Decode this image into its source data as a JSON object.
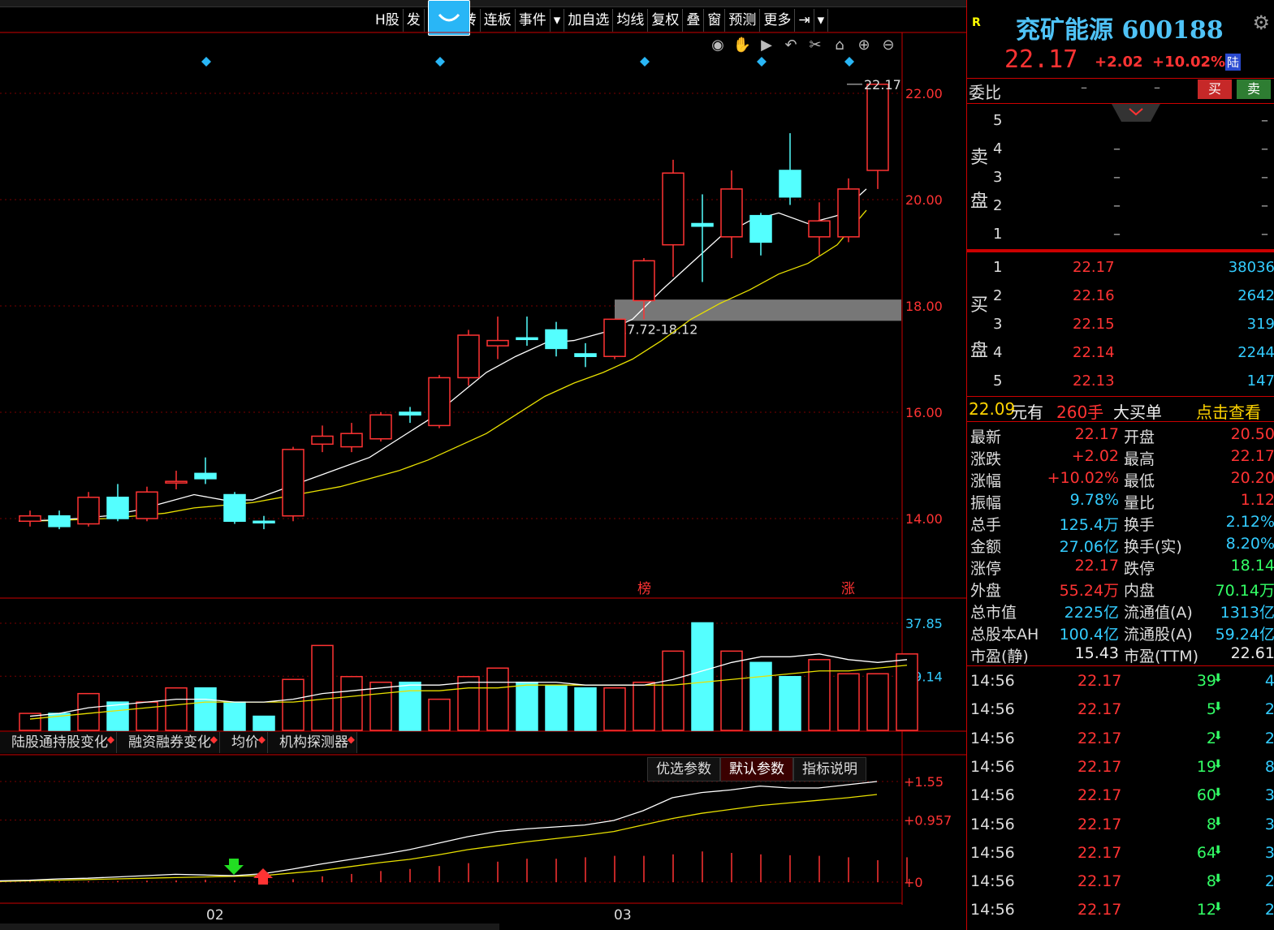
{
  "toolbar": {
    "items": [
      "H股",
      "发",
      "首",
      "九转",
      "连板",
      "事件",
      "▾",
      "加自选",
      "均线",
      "复权",
      "叠",
      "窗",
      "预测",
      "更多",
      "⇥",
      "▾"
    ]
  },
  "stock": {
    "name": "兖矿能源",
    "code": "600188",
    "badge": "R",
    "price": "22.17",
    "change": "+2.02",
    "change_pct": "+10.02%",
    "market_tag": "陆"
  },
  "weibi": {
    "label": "委比",
    "v1": "–",
    "v2": "–",
    "buy": "买",
    "sell": "卖"
  },
  "sell_side_label": [
    "卖",
    "盘"
  ],
  "buy_side_label": [
    "买",
    "盘"
  ],
  "asks": [
    {
      "level": "5",
      "price": "",
      "vol": "–"
    },
    {
      "level": "4",
      "price": "–",
      "vol": "–"
    },
    {
      "level": "3",
      "price": "–",
      "vol": "–"
    },
    {
      "level": "2",
      "price": "–",
      "vol": "–"
    },
    {
      "level": "1",
      "price": "–",
      "vol": "–"
    }
  ],
  "bids": [
    {
      "level": "1",
      "price": "22.17",
      "vol": "38036"
    },
    {
      "level": "2",
      "price": "22.16",
      "vol": "2642"
    },
    {
      "level": "3",
      "price": "22.15",
      "vol": "319"
    },
    {
      "level": "4",
      "price": "22.14",
      "vol": "2244"
    },
    {
      "level": "5",
      "price": "22.13",
      "vol": "147"
    }
  ],
  "big_order": {
    "price": "22.09",
    "yuan_you": "元有",
    "qty": "260手",
    "label": "大买单",
    "link": "点击查看"
  },
  "quote": [
    {
      "k1": "最新",
      "v1": "22.17",
      "c1": "red",
      "k2": "开盘",
      "v2": "20.50",
      "c2": "red"
    },
    {
      "k1": "涨跌",
      "v1": "+2.02",
      "c1": "red",
      "k2": "最高",
      "v2": "22.17",
      "c2": "red"
    },
    {
      "k1": "涨幅",
      "v1": "+10.02%",
      "c1": "red",
      "k2": "最低",
      "v2": "20.20",
      "c2": "red"
    },
    {
      "k1": "振幅",
      "v1": "9.78%",
      "c1": "cyan",
      "k2": "量比",
      "v2": "1.12",
      "c2": "red"
    },
    {
      "k1": "总手",
      "v1": "125.4万",
      "c1": "cyan",
      "k2": "换手",
      "v2": "2.12%",
      "c2": "cyan"
    },
    {
      "k1": "金额",
      "v1": "27.06亿",
      "c1": "cyan",
      "k2": "换手(实)",
      "v2": "8.20%",
      "c2": "cyan"
    },
    {
      "k1": "涨停",
      "v1": "22.17",
      "c1": "red",
      "k2": "跌停",
      "v2": "18.14",
      "c2": "green"
    },
    {
      "k1": "外盘",
      "v1": "55.24万",
      "c1": "red",
      "k2": "内盘",
      "v2": "70.14万",
      "c2": "green"
    },
    {
      "k1": "总市值",
      "v1": "2225亿",
      "c1": "cyan",
      "k2": "流通值(A)",
      "v2": "1313亿",
      "c2": "cyan"
    },
    {
      "k1": "总股本AH",
      "v1": "100.4亿",
      "c1": "cyan",
      "k2": "流通股(A)",
      "v2": "59.24亿",
      "c2": "cyan"
    },
    {
      "k1": "市盈(静)",
      "v1": "15.43",
      "c1": "white",
      "k2": "市盈(TTM)",
      "v2": "22.61",
      "c2": "white"
    }
  ],
  "ticks": [
    {
      "time": "14:56",
      "price": "22.17",
      "vol": "39",
      "num": "4"
    },
    {
      "time": "14:56",
      "price": "22.17",
      "vol": "5",
      "num": "2"
    },
    {
      "time": "14:56",
      "price": "22.17",
      "vol": "2",
      "num": "2"
    },
    {
      "time": "14:56",
      "price": "22.17",
      "vol": "19",
      "num": "8"
    },
    {
      "time": "14:56",
      "price": "22.17",
      "vol": "60",
      "num": "3"
    },
    {
      "time": "14:56",
      "price": "22.17",
      "vol": "8",
      "num": "3"
    },
    {
      "time": "14:56",
      "price": "22.17",
      "vol": "64",
      "num": "3"
    },
    {
      "time": "14:56",
      "price": "22.17",
      "vol": "8",
      "num": "2"
    },
    {
      "time": "14:56",
      "price": "22.17",
      "vol": "12",
      "num": "2"
    }
  ],
  "indicator_tabs": [
    "陆股通持股变化",
    "融资融券变化",
    "均价",
    "机构探测器"
  ],
  "param_buttons": [
    "优选参数",
    "默认参数",
    "指标说明"
  ],
  "chart_data": {
    "type": "candlestick",
    "price_axis": {
      "ticks": [
        "22.00",
        "20.00",
        "18.00",
        "16.00",
        "14.00"
      ],
      "ylim": [
        12.0,
        22.5
      ]
    },
    "high_label": "22.17",
    "zone_label": "17.72-18.12",
    "zone": [
      17.72,
      18.12
    ],
    "markers": [
      "榜",
      "涨"
    ],
    "x_labels": [
      "02",
      "03"
    ],
    "candles": [
      {
        "o": 13.95,
        "c": 14.05,
        "h": 14.15,
        "l": 13.85,
        "up": true
      },
      {
        "o": 14.05,
        "c": 13.85,
        "h": 14.15,
        "l": 13.8,
        "up": false
      },
      {
        "o": 13.9,
        "c": 14.4,
        "h": 14.5,
        "l": 13.85,
        "up": true
      },
      {
        "o": 14.4,
        "c": 14.0,
        "h": 14.65,
        "l": 13.95,
        "up": false
      },
      {
        "o": 14.0,
        "c": 14.5,
        "h": 14.6,
        "l": 13.95,
        "up": true
      },
      {
        "o": 14.7,
        "c": 14.7,
        "h": 14.9,
        "l": 14.55,
        "up": true
      },
      {
        "o": 14.85,
        "c": 14.75,
        "h": 15.15,
        "l": 14.65,
        "up": false
      },
      {
        "o": 14.45,
        "c": 13.95,
        "h": 14.5,
        "l": 13.9,
        "up": false
      },
      {
        "o": 13.95,
        "c": 13.95,
        "h": 14.05,
        "l": 13.8,
        "up": false
      },
      {
        "o": 14.05,
        "c": 15.3,
        "h": 15.35,
        "l": 13.95,
        "up": true
      },
      {
        "o": 15.4,
        "c": 15.55,
        "h": 15.75,
        "l": 15.25,
        "up": true
      },
      {
        "o": 15.35,
        "c": 15.6,
        "h": 15.8,
        "l": 15.25,
        "up": true
      },
      {
        "o": 15.5,
        "c": 15.95,
        "h": 16.0,
        "l": 15.45,
        "up": true
      },
      {
        "o": 16.0,
        "c": 15.95,
        "h": 16.1,
        "l": 15.8,
        "up": false
      },
      {
        "o": 15.75,
        "c": 16.65,
        "h": 16.7,
        "l": 15.7,
        "up": true
      },
      {
        "o": 16.65,
        "c": 17.45,
        "h": 17.55,
        "l": 16.5,
        "up": true
      },
      {
        "o": 17.25,
        "c": 17.35,
        "h": 17.8,
        "l": 17.0,
        "up": true
      },
      {
        "o": 17.4,
        "c": 17.4,
        "h": 17.8,
        "l": 17.25,
        "up": false
      },
      {
        "o": 17.55,
        "c": 17.2,
        "h": 17.7,
        "l": 17.05,
        "up": false
      },
      {
        "o": 17.1,
        "c": 17.05,
        "h": 17.3,
        "l": 16.85,
        "up": false
      },
      {
        "o": 17.05,
        "c": 17.75,
        "h": 17.75,
        "l": 17.0,
        "up": true
      },
      {
        "o": 18.1,
        "c": 18.85,
        "h": 18.9,
        "l": 17.75,
        "up": true
      },
      {
        "o": 19.15,
        "c": 20.5,
        "h": 20.75,
        "l": 18.55,
        "up": true
      },
      {
        "o": 19.55,
        "c": 19.5,
        "h": 20.1,
        "l": 18.45,
        "up": false
      },
      {
        "o": 19.3,
        "c": 20.2,
        "h": 20.55,
        "l": 18.9,
        "up": true
      },
      {
        "o": 19.7,
        "c": 19.2,
        "h": 19.75,
        "l": 18.95,
        "up": false
      },
      {
        "o": 20.55,
        "c": 20.05,
        "h": 21.25,
        "l": 19.9,
        "up": false
      },
      {
        "o": 19.3,
        "c": 19.6,
        "h": 19.95,
        "l": 18.95,
        "up": true
      },
      {
        "o": 19.3,
        "c": 20.2,
        "h": 20.4,
        "l": 19.2,
        "up": true
      },
      {
        "o": 20.55,
        "c": 22.17,
        "h": 22.17,
        "l": 20.2,
        "up": true
      }
    ],
    "ma5": [
      13.95,
      13.97,
      14.0,
      14.05,
      14.15,
      14.3,
      14.45,
      14.35,
      14.35,
      14.55,
      14.75,
      14.95,
      15.15,
      15.5,
      15.85,
      16.3,
      16.75,
      17.05,
      17.3,
      17.35,
      17.5,
      17.75,
      18.3,
      18.8,
      19.3,
      19.6,
      19.75,
      19.55,
      19.7,
      20.2
    ],
    "ma10": [
      13.95,
      13.96,
      13.98,
      14.0,
      14.05,
      14.1,
      14.2,
      14.25,
      14.3,
      14.4,
      14.5,
      14.6,
      14.75,
      14.9,
      15.1,
      15.35,
      15.6,
      15.95,
      16.3,
      16.55,
      16.75,
      17.0,
      17.35,
      17.75,
      18.05,
      18.3,
      18.6,
      18.8,
      19.15,
      19.8
    ],
    "volume_axis": {
      "ticks": [
        "37.85",
        "19.14"
      ],
      "ylim": [
        0,
        40
      ]
    },
    "volumes": [
      6,
      6,
      13,
      10,
      10,
      15,
      15,
      10,
      5,
      18,
      30,
      19,
      17,
      17,
      11,
      19,
      22,
      17,
      16,
      15,
      15,
      17,
      28,
      38,
      28,
      24,
      19,
      25,
      20,
      20,
      27
    ],
    "vol_ma_white": [
      5,
      6,
      8,
      9,
      10,
      11,
      11,
      10,
      10,
      11,
      13,
      14,
      15,
      16,
      16,
      17,
      17,
      17,
      17,
      16,
      16,
      16,
      18,
      21,
      24,
      26,
      26,
      27,
      25,
      24,
      25
    ],
    "vol_ma_yellow": [
      4,
      5,
      6,
      7,
      8,
      9,
      10,
      10,
      10,
      10,
      11,
      12,
      13,
      14,
      14,
      15,
      15,
      16,
      16,
      16,
      16,
      16,
      16,
      17,
      18,
      19,
      20,
      21,
      21,
      22,
      23
    ],
    "macd_axis": {
      "ticks": [
        "+1.55",
        "+0.957",
        "+0"
      ],
      "ylim": [
        0,
        1.65
      ]
    },
    "macd_white": [
      0.02,
      0.03,
      0.05,
      0.06,
      0.08,
      0.1,
      0.12,
      0.11,
      0.1,
      0.13,
      0.2,
      0.28,
      0.35,
      0.42,
      0.5,
      0.6,
      0.7,
      0.78,
      0.82,
      0.85,
      0.88,
      0.95,
      1.1,
      1.3,
      1.38,
      1.42,
      1.48,
      1.45,
      1.45,
      1.5,
      1.55
    ],
    "macd_yellow": [
      0.01,
      0.02,
      0.03,
      0.04,
      0.05,
      0.06,
      0.07,
      0.08,
      0.09,
      0.1,
      0.14,
      0.18,
      0.24,
      0.3,
      0.35,
      0.42,
      0.5,
      0.56,
      0.62,
      0.67,
      0.72,
      0.78,
      0.88,
      0.98,
      1.06,
      1.12,
      1.18,
      1.22,
      1.26,
      1.3,
      1.35
    ],
    "macd_bars": [
      0.02,
      0.02,
      0.03,
      0.04,
      0.05,
      0.06,
      0.08,
      0.06,
      0.03,
      0.1,
      0.2,
      0.28,
      0.38,
      0.45,
      0.55,
      0.65,
      0.7,
      0.8,
      0.8,
      0.85,
      0.9,
      0.9,
      0.95,
      1.05,
      1.0,
      0.95,
      0.92,
      0.9,
      0.85,
      0.75,
      0.85
    ]
  }
}
